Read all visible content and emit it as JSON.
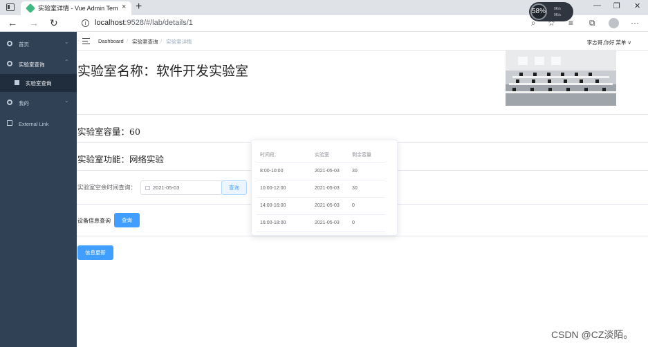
{
  "browser": {
    "tab_title": "实验室详情 - Vue Admin Template",
    "tab_close": "×",
    "new_tab": "+",
    "url_host": "localhost",
    "url_rest": ":9528/#/lab/details/1",
    "perf_percent": "58%",
    "perf_line1": "0K/s",
    "perf_line2": "0K/s",
    "win_min": "—",
    "win_max": "❐",
    "win_close": "✕",
    "back": "←",
    "forward": "→",
    "reload": "↻",
    "more": "···"
  },
  "sidebar": {
    "items": [
      {
        "label": "首页"
      },
      {
        "label": "实验室查询"
      },
      {
        "label": "实验室查询"
      },
      {
        "label": "我的"
      },
      {
        "label": "External Link"
      }
    ]
  },
  "navbar": {
    "breadcrumb": [
      "Dashboard",
      "实验室查询",
      "实验室详情"
    ],
    "separator": "/",
    "greeting": "李志哥,你好 菜单 ∨"
  },
  "lab": {
    "title": "实验室名称：软件开发实验室",
    "capacity": "实验室容量：60",
    "function": "实验室功能：网络实验",
    "free_time_label": "实验室空余时间查询：",
    "date_value": "2021-05-03",
    "query_button": "查询",
    "equipment_label": "设备信息查询",
    "equipment_button": "查询",
    "update_button": "信息更新"
  },
  "schedule": {
    "headers": [
      "时间段",
      "实验室",
      "剩余容量"
    ],
    "rows": [
      [
        "8:00-10:00",
        "2021-05-03",
        "30"
      ],
      [
        "10:00-12:00",
        "2021-05-03",
        "30"
      ],
      [
        "14:00-16:00",
        "2021-05-03",
        "0"
      ],
      [
        "16:00-18:00",
        "2021-05-03",
        "0"
      ]
    ]
  },
  "watermark": "CSDN @CZ淡陌。"
}
